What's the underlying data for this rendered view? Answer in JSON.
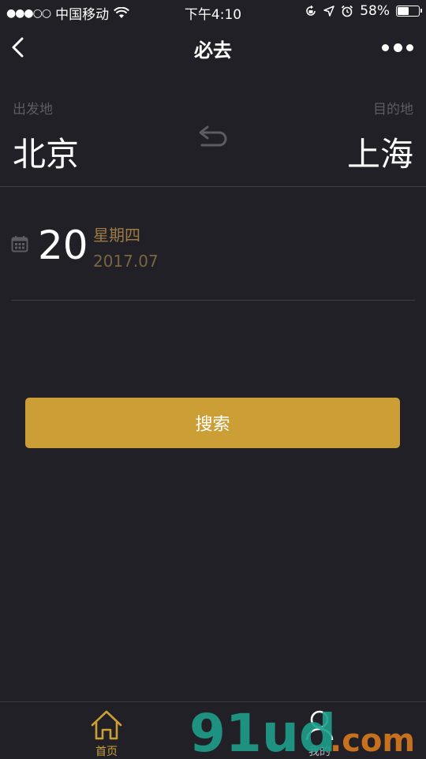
{
  "status_bar": {
    "carrier": "中国移动",
    "time": "下午4:10",
    "battery_text": "58%",
    "battery_level": 0.58
  },
  "nav": {
    "title": "必去"
  },
  "route": {
    "from_label": "出发地",
    "from_city": "北京",
    "to_label": "目的地",
    "to_city": "上海"
  },
  "date": {
    "day": "20",
    "weekday": "星期四",
    "year_month": "2017.07"
  },
  "search": {
    "label": "搜索"
  },
  "tabs": [
    {
      "label": "首页",
      "icon": "home-icon"
    },
    {
      "label": "我的",
      "icon": "user-icon"
    }
  ],
  "colors": {
    "background": "#212026",
    "accent": "#cc9f36",
    "muted_label": "#5d5c62"
  }
}
